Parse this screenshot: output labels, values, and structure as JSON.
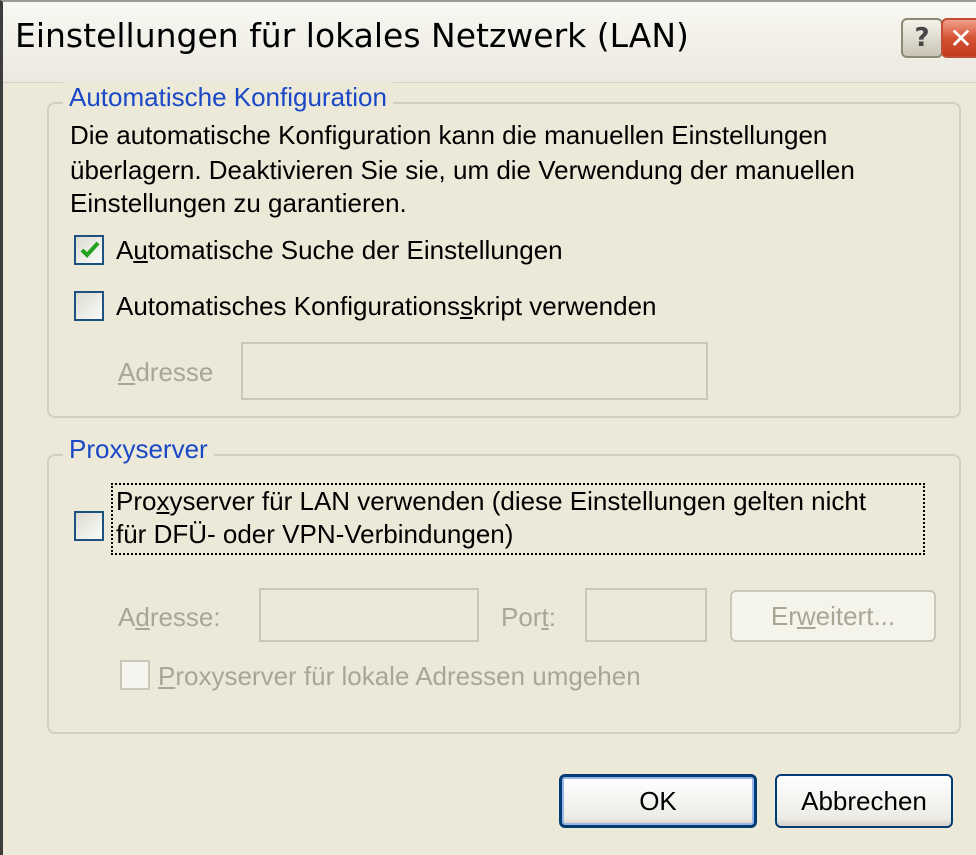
{
  "window": {
    "title": "Einstellungen für lokales Netzwerk (LAN)",
    "help_button": "?",
    "close_button": "✕"
  },
  "auto_config": {
    "legend": "Automatische Konfiguration",
    "description_lines": [
      "Die automatische Konfiguration kann die manuellen Einstellungen",
      "überlagern. Deaktivieren Sie sie, um die Verwendung der manuellen",
      "Einstellungen zu garantieren."
    ],
    "auto_detect": {
      "label_pre": "A",
      "label_accel": "u",
      "label_post": "tomatische Suche der Einstellungen",
      "checked": true
    },
    "use_script": {
      "label_pre": "Automatisches Konfigurations",
      "label_accel": "s",
      "label_post": "kript verwenden",
      "checked": false
    },
    "address": {
      "label_accel": "A",
      "label_post": "dresse",
      "value": ""
    }
  },
  "proxy": {
    "legend": "Proxyserver",
    "use_proxy": {
      "line1_pre": "Pro",
      "line1_accel": "x",
      "line1_post": "yserver für LAN verwenden (diese Einstellungen gelten nicht",
      "line2": "für DFÜ- oder VPN-Verbindungen)",
      "checked": false
    },
    "address": {
      "label_pre": "A",
      "label_accel": "d",
      "label_post": "resse:",
      "value": ""
    },
    "port": {
      "label_pre": "Por",
      "label_accel": "t",
      "label_post": ":",
      "value": ""
    },
    "advanced_button": {
      "label_pre": "Er",
      "label_accel": "w",
      "label_post": "eitert..."
    },
    "bypass_local": {
      "label_accel": "P",
      "label_post": "roxyserver für lokale Adressen umgehen",
      "checked": false
    }
  },
  "buttons": {
    "ok": "OK",
    "cancel": "Abbrechen"
  },
  "colors": {
    "window_bg": "#ece9d8",
    "group_legend": "#1a48c7",
    "disabled_text": "#a8a796",
    "check_green": "#21a121"
  }
}
